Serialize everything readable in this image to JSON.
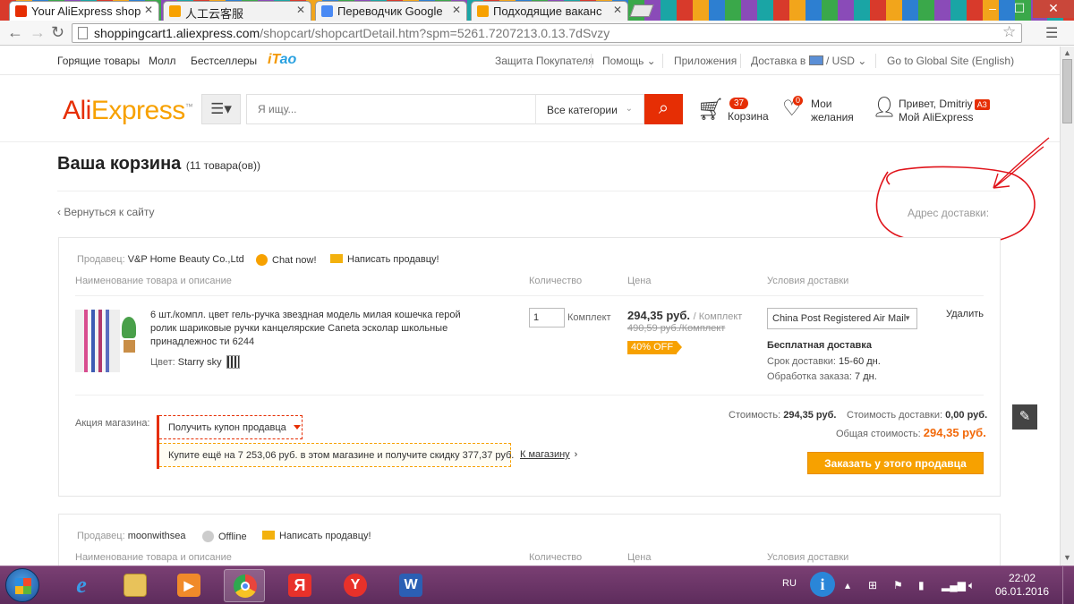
{
  "browser": {
    "tabs": [
      {
        "label": "Your AliExpress shop",
        "color": "#e62e04"
      },
      {
        "label": "人工云客服",
        "color": "#f7a100"
      },
      {
        "label": "Переводчик Google",
        "color": "#4a8af4"
      },
      {
        "label": "Подходящие ваканс",
        "color": "#f7a100"
      }
    ],
    "url_host": "shoppingcart1.aliexpress.com",
    "url_path": "/shopcart/shopcartDetail.htm?spm=5261.7207213.0.13.7dSvzy"
  },
  "topnav": {
    "hot": "Горящие товары",
    "mall": "Молл",
    "bestsellers": "Бестселлеры",
    "itao_a": "iT",
    "itao_b": "ao",
    "protection": "Защита Покупателя",
    "help": "Помощь ⌄",
    "apps": "Приложения",
    "ship_to": "Доставка в",
    "currency": "/ USD ⌄",
    "global": "Go to Global Site (English)"
  },
  "header": {
    "logo_a": "Ali",
    "logo_b": "Express",
    "logo_tm": "™",
    "cat_icon": "☰▾",
    "search_placeholder": "Я ищу...",
    "category": "Все категории",
    "cart_count": "37",
    "cart_label": "Корзина",
    "wish_count": "0",
    "wish_label": "Мои желания",
    "hello": "Привет, Dmitriy",
    "badge": "A3",
    "my_ali": "Мой AliExpress"
  },
  "cart": {
    "title": "Ваша корзина",
    "count": "(11 товара(ов))",
    "back": "‹ Вернуться к сайту",
    "address": "Адрес доставки:"
  },
  "seller1": {
    "label": "Продавец:",
    "name": "V&P Home Beauty Co.,Ltd",
    "chat": "Chat now!",
    "write": "Написать продавцу!",
    "col_name": "Наименование товара и описание",
    "col_qty": "Количество",
    "col_price": "Цена",
    "col_ship": "Условия доставки",
    "desc": "6 шт./компл. цвет гель-ручка звездная модель милая кошечка герой ролик шариковые ручки канцелярские Caneta эсколар школьные принадлежнос ти 6244",
    "color_label": "Цвет:",
    "color_value": "Starry sky",
    "qty": "1",
    "qty_unit": "Комплект",
    "price": "294,35 руб.",
    "price_unit": "/ Комплект",
    "old_price": "490,59 руб./Комплект",
    "discount": "40% OFF",
    "ship_method": "China Post Registered Air Mail",
    "remove": "Удалить",
    "free_ship": "Бесплатная доставка",
    "term_label": "Срок доставки:",
    "term_value": "15-60 дн.",
    "proc_label": "Обработка заказа:",
    "proc_value": "7 дн.",
    "promo_label": "Акция магазина:",
    "coupon": "Получить купон продавца",
    "buy_more": "Купите ещё на 7 253,06 руб. в этом магазине и получите скидку 377,37 руб.",
    "to_store": "К магазину",
    "cost_label": "Стоимость:",
    "cost_value": "294,35 руб.",
    "ship_cost_label": "Стоимость доставки:",
    "ship_cost_value": "0,00 руб.",
    "total_label": "Общая стоимость:",
    "total_value": "294,35 руб.",
    "order_btn": "Заказать у этого продавца"
  },
  "seller2": {
    "label": "Продавец:",
    "name": "moonwithsea",
    "status": "Offline",
    "write": "Написать продавцу!",
    "col_name": "Наименование товара и описание",
    "col_qty": "Количество",
    "col_price": "Цена",
    "col_ship": "Условия доставки"
  },
  "taskbar": {
    "lang": "RU",
    "time": "22:02",
    "date": "06.01.2016"
  }
}
